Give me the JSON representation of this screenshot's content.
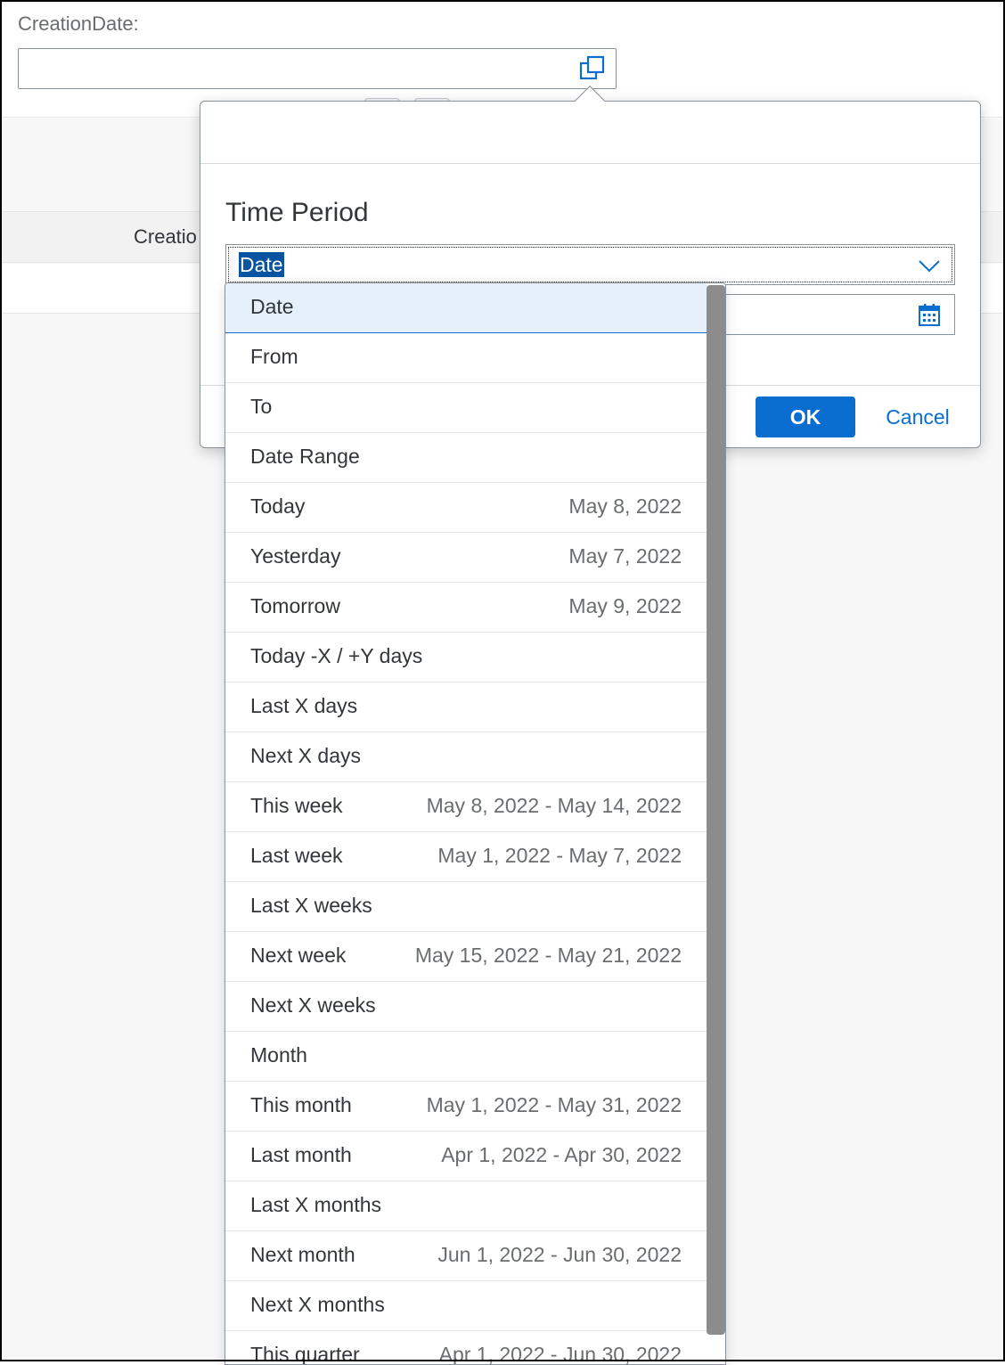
{
  "filter": {
    "label": "CreationDate:",
    "value": "",
    "value_help_icon": "value-help-icon"
  },
  "table": {
    "header_text": "Creatio"
  },
  "dialog": {
    "section_title": "Time Period",
    "select_value": "Date",
    "select_arrow_icon": "chevron-down-icon",
    "date_input_icon": "calendar-icon",
    "ok_label": "OK",
    "cancel_label": "Cancel"
  },
  "dropdown": {
    "items": [
      {
        "label": "Date",
        "range": "",
        "selected": true
      },
      {
        "label": "From",
        "range": ""
      },
      {
        "label": "To",
        "range": ""
      },
      {
        "label": "Date Range",
        "range": ""
      },
      {
        "label": "Today",
        "range": "May 8, 2022"
      },
      {
        "label": "Yesterday",
        "range": "May 7, 2022"
      },
      {
        "label": "Tomorrow",
        "range": "May 9, 2022"
      },
      {
        "label": "Today -X / +Y days",
        "range": ""
      },
      {
        "label": "Last X days",
        "range": ""
      },
      {
        "label": "Next X days",
        "range": ""
      },
      {
        "label": "This week",
        "range": "May 8, 2022 - May 14, 2022"
      },
      {
        "label": "Last week",
        "range": "May 1, 2022 - May 7, 2022"
      },
      {
        "label": "Last X weeks",
        "range": ""
      },
      {
        "label": "Next week",
        "range": "May 15, 2022 - May 21, 2022"
      },
      {
        "label": "Next X weeks",
        "range": ""
      },
      {
        "label": "Month",
        "range": ""
      },
      {
        "label": "This month",
        "range": "May 1, 2022 - May 31, 2022"
      },
      {
        "label": "Last month",
        "range": "Apr 1, 2022 - Apr 30, 2022"
      },
      {
        "label": "Last X months",
        "range": ""
      },
      {
        "label": "Next month",
        "range": "Jun 1, 2022 - Jun 30, 2022"
      },
      {
        "label": "Next X months",
        "range": ""
      },
      {
        "label": "This quarter",
        "range": "Apr 1, 2022 - Jun 30, 2022"
      }
    ]
  },
  "colors": {
    "accent": "#0a6ed1",
    "selection_bg": "#e5f0fa",
    "text_selected_bg": "#0854a0"
  }
}
